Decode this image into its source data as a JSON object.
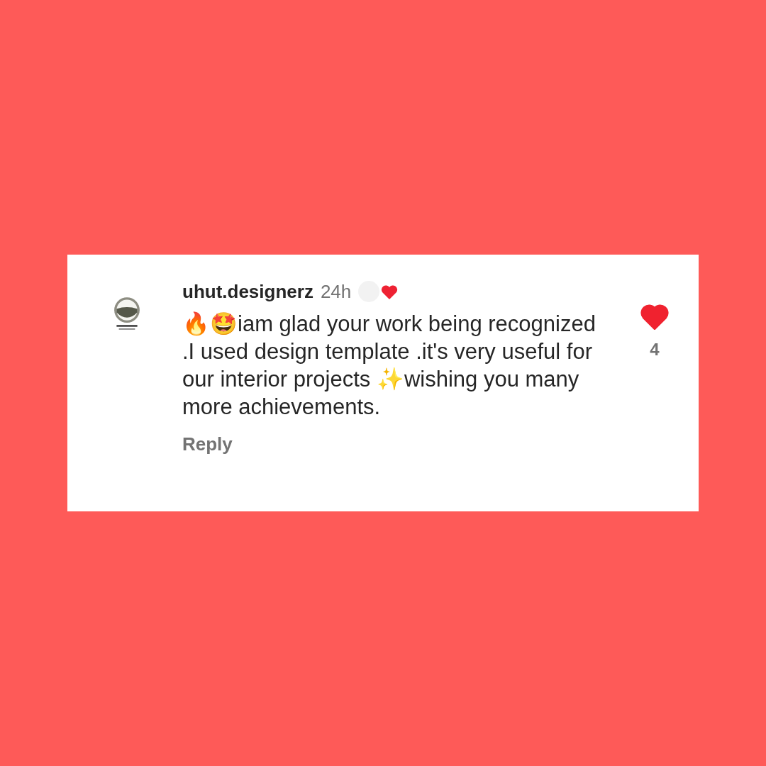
{
  "comment": {
    "username": "uhut.designerz",
    "time": "24h",
    "text": "🔥🤩iam glad your work being recognized .I used design template .it's very useful for our interior projects ✨wishing you many more achievements.",
    "reply": "Reply",
    "creator_liked": true,
    "like": {
      "liked": true,
      "count": "4"
    }
  }
}
